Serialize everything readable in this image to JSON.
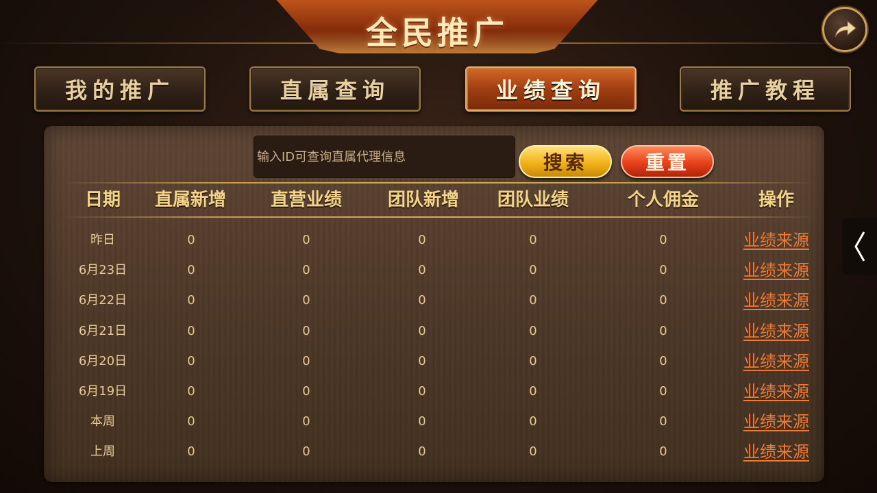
{
  "header": {
    "title": "全民推广"
  },
  "tabs": [
    {
      "label": "我的推广",
      "active": false
    },
    {
      "label": "直属查询",
      "active": false
    },
    {
      "label": "业绩查询",
      "active": true
    },
    {
      "label": "推广教程",
      "active": false
    }
  ],
  "search": {
    "placeholder": "输入ID可查询直属代理信息",
    "search_label": "搜索",
    "reset_label": "重置"
  },
  "table": {
    "columns": [
      "日期",
      "直属新增",
      "直营业绩",
      "团队新增",
      "团队业绩",
      "个人佣金",
      "操作"
    ],
    "rows": [
      {
        "date": "昨日",
        "direct_new": "0",
        "direct_perf": "0",
        "team_new": "0",
        "team_perf": "0",
        "commission": "0",
        "action": "业绩来源"
      },
      {
        "date": "6月23日",
        "direct_new": "0",
        "direct_perf": "0",
        "team_new": "0",
        "team_perf": "0",
        "commission": "0",
        "action": "业绩来源"
      },
      {
        "date": "6月22日",
        "direct_new": "0",
        "direct_perf": "0",
        "team_new": "0",
        "team_perf": "0",
        "commission": "0",
        "action": "业绩来源"
      },
      {
        "date": "6月21日",
        "direct_new": "0",
        "direct_perf": "0",
        "team_new": "0",
        "team_perf": "0",
        "commission": "0",
        "action": "业绩来源"
      },
      {
        "date": "6月20日",
        "direct_new": "0",
        "direct_perf": "0",
        "team_new": "0",
        "team_perf": "0",
        "commission": "0",
        "action": "业绩来源"
      },
      {
        "date": "6月19日",
        "direct_new": "0",
        "direct_perf": "0",
        "team_new": "0",
        "team_perf": "0",
        "commission": "0",
        "action": "业绩来源"
      },
      {
        "date": "本周",
        "direct_new": "0",
        "direct_perf": "0",
        "team_new": "0",
        "team_perf": "0",
        "commission": "0",
        "action": "业绩来源"
      },
      {
        "date": "上周",
        "direct_new": "0",
        "direct_perf": "0",
        "team_new": "0",
        "team_perf": "0",
        "commission": "0",
        "action": "业绩来源"
      }
    ]
  },
  "icons": {
    "back": "back-arrow-icon",
    "side": "chevron-left-icon"
  },
  "colors": {
    "accent": "#d46a2a",
    "gold": "#f2d48a",
    "link": "#f07a34"
  }
}
